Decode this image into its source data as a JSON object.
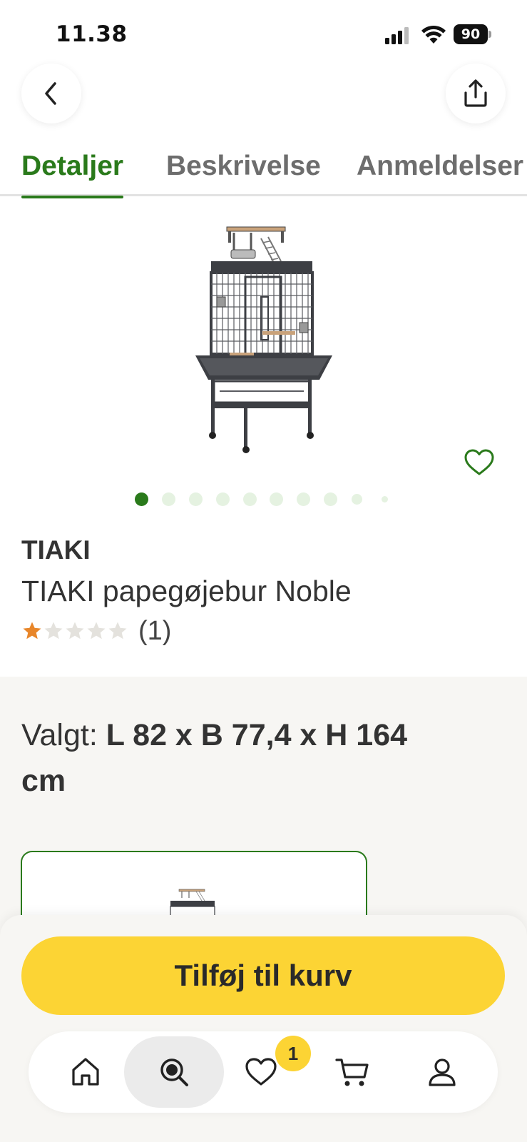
{
  "status_bar": {
    "time": "11.38",
    "battery": "90"
  },
  "nav": {
    "back_icon": "chevron-left-icon",
    "share_icon": "share-icon"
  },
  "tabs": [
    {
      "label": "Detaljer",
      "active": true
    },
    {
      "label": "Beskrivelse",
      "active": false
    },
    {
      "label": "Anmeldelser",
      "active": false
    }
  ],
  "carousel": {
    "total_dots": 10,
    "active_index": 0
  },
  "product": {
    "brand": "TIAKI",
    "name": "TIAKI papegøjebur Noble",
    "rating": 1,
    "rating_max": 5,
    "review_count": "(1)"
  },
  "variant": {
    "label": "Valgt:",
    "value": "L 82 x B 77,4 x H 164 cm"
  },
  "cta": {
    "add_to_cart_label": "Tilføj til kurv"
  },
  "bottom_nav": {
    "items": [
      {
        "icon": "home-icon",
        "selected": false
      },
      {
        "icon": "search-icon",
        "selected": true
      },
      {
        "icon": "heart-icon",
        "selected": false
      },
      {
        "icon": "cart-icon",
        "selected": false
      },
      {
        "icon": "profile-icon",
        "selected": false
      }
    ],
    "favorites_badge": "1"
  },
  "colors": {
    "accent_green": "#2a7a1b",
    "cta_yellow": "#fcd434",
    "star_orange": "#e8862a",
    "section_bg": "#f7f6f3"
  }
}
